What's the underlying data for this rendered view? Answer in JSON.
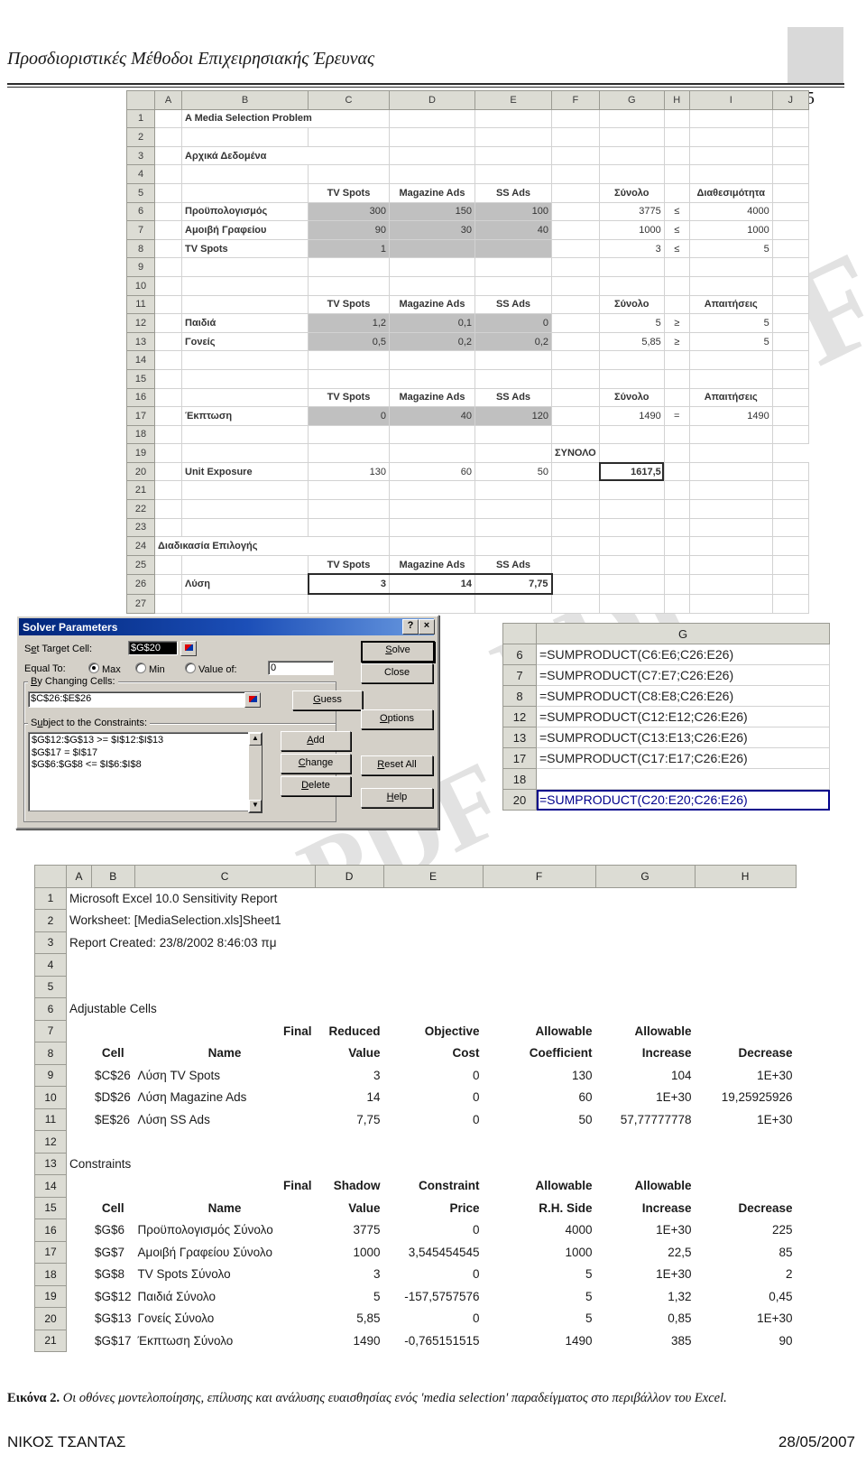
{
  "header": {
    "title": "Προσδιοριστικές Μέθοδοι Επιχειρησιακής Έρευνας",
    "page_number": "5"
  },
  "watermark": {
    "text": "PDF"
  },
  "sheet1": {
    "col_headers": [
      "A",
      "B",
      "C",
      "D",
      "E",
      "F",
      "G",
      "H",
      "I",
      "J"
    ],
    "row_numbers": [
      "1",
      "2",
      "3",
      "4",
      "5",
      "6",
      "7",
      "8",
      "9",
      "10",
      "11",
      "12",
      "13",
      "14",
      "15",
      "16",
      "17",
      "18",
      "19",
      "20",
      "21",
      "22",
      "23",
      "24",
      "25",
      "26",
      "27"
    ],
    "cells": {
      "title": "A Media Selection Problem",
      "section_data": "Αρχικά Δεδομένα",
      "section_procedure": "Διαδικασία Επιλογής",
      "hdr_tv": "TV Spots",
      "hdr_mag": "Magazine Ads",
      "hdr_ss": "SS Ads",
      "hdr_total": "Σύνολο",
      "hdr_availability": "Διαθεσιμότητα",
      "hdr_requirements": "Απαιτήσεις",
      "hdr_grandtotal": "ΣΥΝΟΛΟ",
      "lbl_budget": "Προϋπολογισμός",
      "lbl_agencyfee": "Αμοιβή Γραφείου",
      "lbl_tvspots": "TV Spots",
      "lbl_children": "Παιδιά",
      "lbl_parents": "Γονείς",
      "lbl_discount": "Έκπτωση",
      "lbl_unitexposure": "Unit Exposure",
      "lbl_solution": "Λύση"
    },
    "rows": [
      {
        "n": "6",
        "label": "Προϋπολογισμός",
        "c": "300",
        "d": "150",
        "e": "100",
        "g": "3775",
        "h": "≤",
        "i": "4000"
      },
      {
        "n": "7",
        "label": "Αμοιβή Γραφείου",
        "c": "90",
        "d": "30",
        "e": "40",
        "g": "1000",
        "h": "≤",
        "i": "1000"
      },
      {
        "n": "8",
        "label": "TV Spots",
        "c": "1",
        "d": "",
        "e": "",
        "g": "3",
        "h": "≤",
        "i": "5"
      },
      {
        "n": "12",
        "label": "Παιδιά",
        "c": "1,2",
        "d": "0,1",
        "e": "0",
        "g": "5",
        "h": "≥",
        "i": "5"
      },
      {
        "n": "13",
        "label": "Γονείς",
        "c": "0,5",
        "d": "0,2",
        "e": "0,2",
        "g": "5,85",
        "h": "≥",
        "i": "5"
      },
      {
        "n": "17",
        "label": "Έκπτωση",
        "c": "0",
        "d": "40",
        "e": "120",
        "g": "1490",
        "h": "=",
        "i": "1490"
      },
      {
        "n": "20",
        "label": "Unit Exposure",
        "c": "130",
        "d": "60",
        "e": "50",
        "g": "1617,5",
        "h": "",
        "i": ""
      },
      {
        "n": "26",
        "label": "Λύση",
        "c": "3",
        "d": "14",
        "e": "7,75",
        "g": "",
        "h": "",
        "i": ""
      }
    ]
  },
  "solver": {
    "title": "Solver Parameters",
    "help_btn": "?",
    "close_btn": "×",
    "set_target_cell_label": "Set Target Cell:",
    "set_target_cell_value": "$G$20",
    "equal_to_label": "Equal To:",
    "radio_max": "Max",
    "radio_min": "Min",
    "radio_value_of": "Value of:",
    "value_of_field": "0",
    "selected_radio": "Max",
    "by_changing_cells_label": "By Changing Cells:",
    "by_changing_cells_value": "$C$26:$E$26",
    "constraints_label": "Subject to the Constraints:",
    "constraints": [
      "$G$12:$G$13 >= $I$12:$I$13",
      "$G$17 = $I$17",
      "$G$6:$G$8 <= $I$6:$I$8"
    ],
    "buttons": {
      "solve": "Solve",
      "close": "Close",
      "options": "Options",
      "reset_all": "Reset All",
      "help": "Help",
      "guess": "Guess",
      "add": "Add",
      "change": "Change",
      "delete": "Delete"
    }
  },
  "formula_panel": {
    "col_header": "G",
    "rows": [
      {
        "n": "6",
        "formula": "=SUMPRODUCT(C6:E6;C26:E26)",
        "selected": false
      },
      {
        "n": "7",
        "formula": "=SUMPRODUCT(C7:E7;C26:E26)",
        "selected": false
      },
      {
        "n": "8",
        "formula": "=SUMPRODUCT(C8:E8;C26:E26)",
        "selected": false
      },
      {
        "n": "12",
        "formula": "=SUMPRODUCT(C12:E12;C26:E26)",
        "selected": false
      },
      {
        "n": "13",
        "formula": "=SUMPRODUCT(C13:E13;C26:E26)",
        "selected": false
      },
      {
        "n": "17",
        "formula": "=SUMPRODUCT(C17:E17;C26:E26)",
        "selected": false
      },
      {
        "n": "18",
        "formula": "",
        "selected": false
      },
      {
        "n": "20",
        "formula": "=SUMPRODUCT(C20:E20;C26:E26)",
        "selected": true
      }
    ]
  },
  "sensitivity": {
    "col_headers": [
      "A",
      "B",
      "C",
      "D",
      "E",
      "F",
      "G",
      "H"
    ],
    "line1": "Microsoft Excel 10.0 Sensitivity Report",
    "line2": "Worksheet: [MediaSelection.xls]Sheet1",
    "line3": "Report Created: 23/8/2002 8:46:03 πμ",
    "adjustable_cells_title": "Adjustable Cells",
    "constraints_title": "Constraints",
    "adjustable_headers_top": [
      "",
      "",
      "Final",
      "Reduced",
      "Objective",
      "Allowable",
      "Allowable"
    ],
    "adjustable_headers_bottom": [
      "Cell",
      "Name",
      "Value",
      "Cost",
      "Coefficient",
      "Increase",
      "Decrease"
    ],
    "adjustable_rows": [
      {
        "n": "9",
        "cell": "$C$26",
        "name": "Λύση TV Spots",
        "value": "3",
        "cost": "0",
        "coef": "130",
        "inc": "104",
        "dec": "1E+30"
      },
      {
        "n": "10",
        "cell": "$D$26",
        "name": "Λύση Magazine Ads",
        "value": "14",
        "cost": "0",
        "coef": "60",
        "inc": "1E+30",
        "dec": "19,25925926"
      },
      {
        "n": "11",
        "cell": "$E$26",
        "name": "Λύση SS Ads",
        "value": "7,75",
        "cost": "0",
        "coef": "50",
        "inc": "57,77777778",
        "dec": "1E+30"
      }
    ],
    "constraint_headers_top": [
      "",
      "",
      "Final",
      "Shadow",
      "Constraint",
      "Allowable",
      "Allowable"
    ],
    "constraint_headers_bottom": [
      "Cell",
      "Name",
      "Value",
      "Price",
      "R.H. Side",
      "Increase",
      "Decrease"
    ],
    "constraint_rows": [
      {
        "n": "16",
        "cell": "$G$6",
        "name": "Προϋπολογισμός Σύνολο",
        "value": "3775",
        "price": "0",
        "rhs": "4000",
        "inc": "1E+30",
        "dec": "225"
      },
      {
        "n": "17",
        "cell": "$G$7",
        "name": "Αμοιβή Γραφείου Σύνολο",
        "value": "1000",
        "price": "3,545454545",
        "rhs": "1000",
        "inc": "22,5",
        "dec": "85"
      },
      {
        "n": "18",
        "cell": "$G$8",
        "name": "TV Spots Σύνολο",
        "value": "3",
        "price": "0",
        "rhs": "5",
        "inc": "1E+30",
        "dec": "2"
      },
      {
        "n": "19",
        "cell": "$G$12",
        "name": "Παιδιά Σύνολο",
        "value": "5",
        "price": "-157,5757576",
        "rhs": "5",
        "inc": "1,32",
        "dec": "0,45"
      },
      {
        "n": "20",
        "cell": "$G$13",
        "name": "Γονείς Σύνολο",
        "value": "5,85",
        "price": "0",
        "rhs": "5",
        "inc": "0,85",
        "dec": "1E+30"
      },
      {
        "n": "21",
        "cell": "$G$17",
        "name": "Έκπτωση Σύνολο",
        "value": "1490",
        "price": "-0,765151515",
        "rhs": "1490",
        "inc": "385",
        "dec": "90"
      }
    ],
    "empty_row_numbers": [
      "4",
      "5",
      "12"
    ]
  },
  "caption": {
    "label": "Εικόνα 2.",
    "text": " Οι οθόνες μοντελοποίησης, επίλυσης και ανάλυσης ευαισθησίας ενός 'media selection' παραδείγματος στο περιβάλλον του Excel."
  },
  "footer": {
    "left": "ΝΙΚΟΣ ΤΣΑΝΤΑΣ",
    "right": "28/05/2007"
  }
}
